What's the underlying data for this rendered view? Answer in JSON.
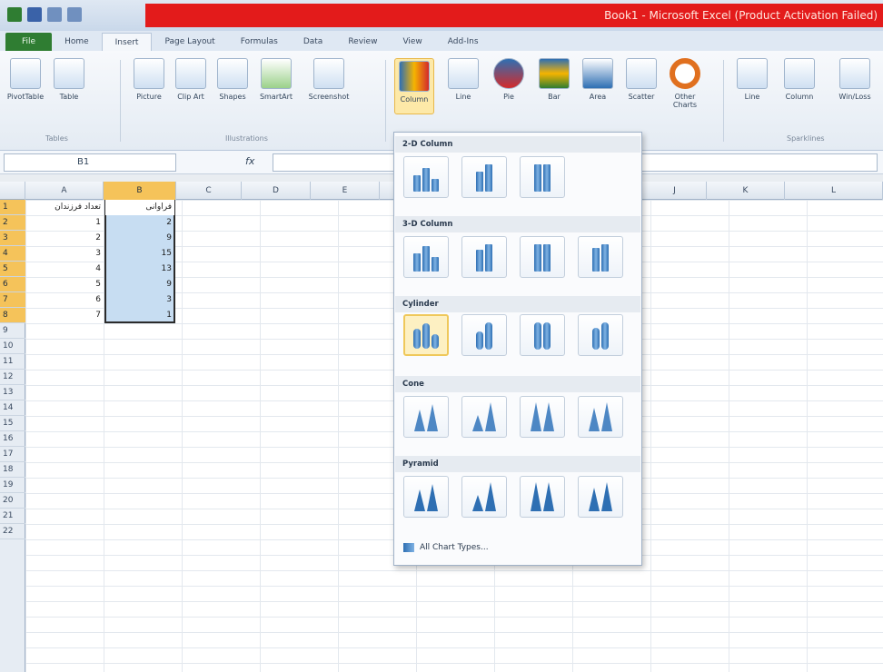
{
  "window": {
    "title": "Book1 - Microsoft Excel (Product Activation Failed)"
  },
  "tabs": [
    "File",
    "Home",
    "Insert",
    "Page Layout",
    "Formulas",
    "Data",
    "Review",
    "View",
    "Add-Ins"
  ],
  "ribbon": {
    "tables": {
      "group": "Tables",
      "buttons": [
        "PivotTable",
        "Table"
      ]
    },
    "illustrations": {
      "group": "Illustrations",
      "buttons": [
        "Picture",
        "Clip Art",
        "Shapes",
        "SmartArt",
        "Screenshot"
      ]
    },
    "charts": {
      "buttons": [
        "Column",
        "Line",
        "Pie",
        "Bar",
        "Area",
        "Scatter",
        "Other Charts"
      ]
    },
    "sparklines": {
      "group": "Sparklines",
      "buttons": [
        "Line",
        "Column",
        "Win/Loss"
      ]
    }
  },
  "formula_bar": {
    "name_box": "B1",
    "fx": "fx",
    "value": ""
  },
  "columns": [
    "A",
    "B",
    "C",
    "D",
    "E",
    "",
    "",
    "",
    "",
    "J",
    "K",
    "L"
  ],
  "rows": [
    "1",
    "2",
    "3",
    "4",
    "5",
    "6",
    "7",
    "8",
    "9",
    "10",
    "11",
    "12",
    "13",
    "14",
    "15",
    "16",
    "17",
    "18",
    "19",
    "20",
    "21",
    "22"
  ],
  "cells": {
    "A": [
      "تعداد فرزندان",
      "1",
      "2",
      "3",
      "4",
      "5",
      "6",
      "7"
    ],
    "B": [
      "فراوانی",
      "2",
      "9",
      "15",
      "13",
      "9",
      "3",
      "1"
    ]
  },
  "dropdown": {
    "sections": [
      "2-D Column",
      "3-D Column",
      "Cylinder",
      "Cone",
      "Pyramid"
    ],
    "footer": "All Chart Types..."
  },
  "colors": {
    "file_tab": "#2f7d32",
    "title_bar": "#e31b1b",
    "selection": "#f5c35a"
  }
}
